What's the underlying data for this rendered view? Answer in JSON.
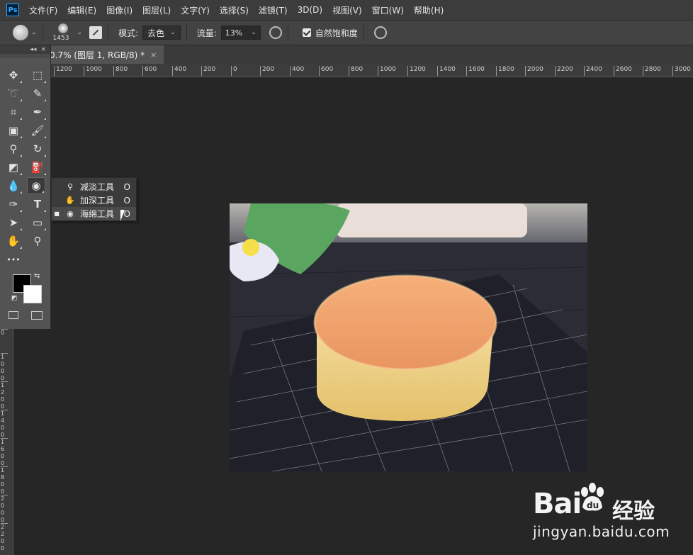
{
  "menubar": {
    "logo": "Ps",
    "items": [
      "文件(F)",
      "编辑(E)",
      "图像(I)",
      "图层(L)",
      "文字(Y)",
      "选择(S)",
      "滤镜(T)",
      "3D(D)",
      "视图(V)",
      "窗口(W)",
      "帮助(H)"
    ]
  },
  "options": {
    "brush_size": "1453",
    "mode_label": "模式:",
    "mode_value": "去色",
    "flow_label": "流量:",
    "flow_value": "13%",
    "vibrance_label": "自然饱和度",
    "vibrance_checked": true
  },
  "document": {
    "tab_title": "0.7% (图层 1, RGB/8) *",
    "close": "×"
  },
  "hruler": [
    "1200",
    "1000",
    "800",
    "600",
    "400",
    "200",
    "0",
    "200",
    "400",
    "600",
    "800",
    "1000",
    "1200",
    "1400",
    "1600",
    "1800",
    "2000",
    "2200",
    "2400",
    "2600",
    "2800",
    "3000"
  ],
  "vruler": [
    "0",
    "1000",
    "1200",
    "1400",
    "1600",
    "1800",
    "2000",
    "2200"
  ],
  "toolbox": {
    "collapse": "◂◂",
    "close": "×",
    "tools": [
      {
        "name": "move-tool",
        "glyph": "✥"
      },
      {
        "name": "marquee-tool",
        "glyph": "⬚"
      },
      {
        "name": "lasso-tool",
        "glyph": "➰"
      },
      {
        "name": "quick-select-tool",
        "glyph": "✎"
      },
      {
        "name": "crop-tool",
        "glyph": "⌗"
      },
      {
        "name": "eyedropper-tool",
        "glyph": "✒"
      },
      {
        "name": "frame-tool",
        "glyph": "▣"
      },
      {
        "name": "brush-tool",
        "glyph": "🖌"
      },
      {
        "name": "stamp-tool",
        "glyph": "⚲"
      },
      {
        "name": "history-brush-tool",
        "glyph": "↻"
      },
      {
        "name": "eraser-tool",
        "glyph": "◩"
      },
      {
        "name": "paint-bucket-tool",
        "glyph": "⛽"
      },
      {
        "name": "blur-tool",
        "glyph": "💧"
      },
      {
        "name": "sponge-tool",
        "glyph": "◉"
      },
      {
        "name": "pen-tool",
        "glyph": "✑"
      },
      {
        "name": "type-tool",
        "glyph": "T"
      },
      {
        "name": "path-select-tool",
        "glyph": "➤"
      },
      {
        "name": "rectangle-tool",
        "glyph": "▭"
      },
      {
        "name": "hand-tool",
        "glyph": "✋"
      },
      {
        "name": "zoom-tool",
        "glyph": "⚲"
      },
      {
        "name": "more-tools",
        "glyph": "•••"
      }
    ]
  },
  "flyout": {
    "items": [
      {
        "label": "减淡工具",
        "key": "O",
        "icon": "dodge-icon",
        "glyph": "⚲",
        "selected": false
      },
      {
        "label": "加深工具",
        "key": "O",
        "icon": "burn-icon",
        "glyph": "✋",
        "selected": false
      },
      {
        "label": "海绵工具",
        "key": "O",
        "icon": "sponge-icon",
        "glyph": "◉",
        "selected": true
      }
    ]
  },
  "colors": {
    "foreground": "#000000",
    "background": "#ffffff",
    "cake_top": "#f0a06a",
    "cake_side": "#f2d48a"
  },
  "watermark": {
    "big": "Bai",
    "du": "du",
    "cn": "经验",
    "url": "jingyan.baidu.com"
  }
}
